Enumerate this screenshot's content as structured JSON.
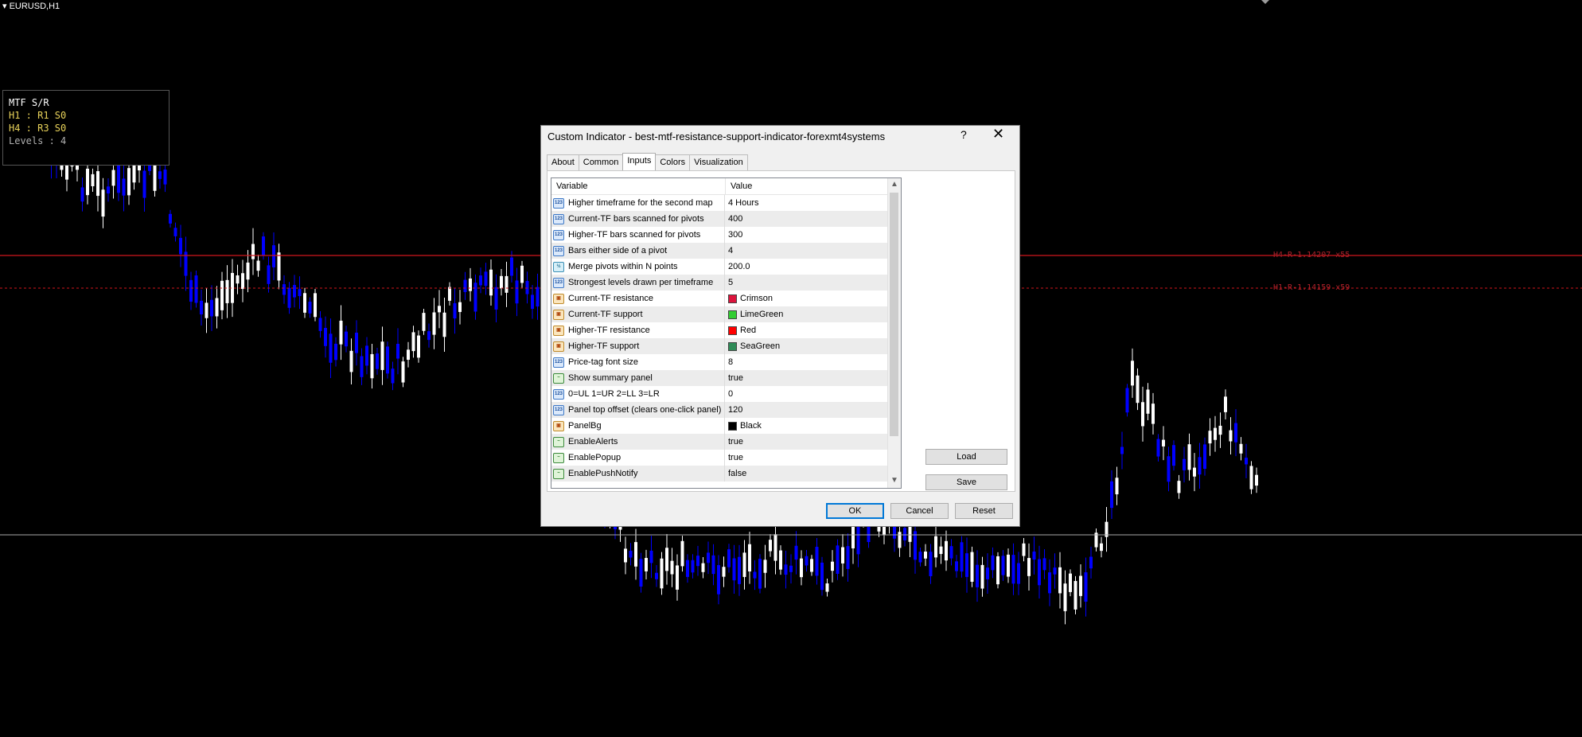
{
  "chart": {
    "symbol_label": "EURUSD,H1",
    "level_lines": [
      {
        "label": "H4-R-1.14207 x55"
      },
      {
        "label": "H1-R-1.14159 x59"
      }
    ]
  },
  "summary_panel": {
    "title": "MTF S/R",
    "line_h1": "H1 : R1 S0",
    "line_h4": "H4 : R3 S0",
    "line_levels": "Levels : 4"
  },
  "dialog": {
    "title": "Custom Indicator - best-mtf-resistance-support-indicator-forexmt4systems",
    "help_label": "?",
    "close_label": "✕",
    "tabs": [
      "About",
      "Common",
      "Inputs",
      "Colors",
      "Visualization"
    ],
    "active_tab": "Inputs",
    "grid": {
      "headers": {
        "variable": "Variable",
        "value": "Value"
      },
      "rows": [
        {
          "variable": "Higher timeframe for the second map",
          "value": "4 Hours",
          "icon": "integer-icon"
        },
        {
          "variable": "Current-TF bars scanned for pivots",
          "value": "400",
          "icon": "integer-icon"
        },
        {
          "variable": "Higher-TF bars scanned for pivots",
          "value": "300",
          "icon": "integer-icon"
        },
        {
          "variable": "Bars either side of a pivot",
          "value": "4",
          "icon": "integer-icon"
        },
        {
          "variable": "Merge pivots within N points",
          "value": "200.0",
          "icon": "double-icon"
        },
        {
          "variable": "Strongest levels drawn per timeframe",
          "value": "5",
          "icon": "integer-icon"
        },
        {
          "variable": "Current-TF resistance",
          "value": "Crimson",
          "icon": "color-icon",
          "swatch": "#dc143c"
        },
        {
          "variable": "Current-TF support",
          "value": "LimeGreen",
          "icon": "color-icon",
          "swatch": "#32cd32"
        },
        {
          "variable": "Higher-TF resistance",
          "value": "Red",
          "icon": "color-icon",
          "swatch": "#ff0000"
        },
        {
          "variable": "Higher-TF support",
          "value": "SeaGreen",
          "icon": "color-icon",
          "swatch": "#2e8b57"
        },
        {
          "variable": "Price-tag font size",
          "value": "8",
          "icon": "integer-icon"
        },
        {
          "variable": "Show summary panel",
          "value": "true",
          "icon": "bool-icon"
        },
        {
          "variable": "0=UL 1=UR 2=LL 3=LR",
          "value": "0",
          "icon": "integer-icon"
        },
        {
          "variable": "Panel top offset (clears one-click panel)",
          "value": "120",
          "icon": "integer-icon"
        },
        {
          "variable": "PanelBg",
          "value": "Black",
          "icon": "color-icon",
          "swatch": "#000000"
        },
        {
          "variable": "EnableAlerts",
          "value": "true",
          "icon": "bool-icon"
        },
        {
          "variable": "EnablePopup",
          "value": "true",
          "icon": "bool-icon"
        },
        {
          "variable": "EnablePushNotify",
          "value": "false",
          "icon": "bool-icon"
        }
      ]
    },
    "buttons": {
      "load": "Load",
      "save": "Save",
      "ok": "OK",
      "cancel": "Cancel",
      "reset": "Reset"
    }
  },
  "colors": {
    "bull_candle": "#ffffff",
    "bear_candle": "#0000ff",
    "resistance_line": "#d0161d",
    "price_line": "#a8a8a8"
  }
}
